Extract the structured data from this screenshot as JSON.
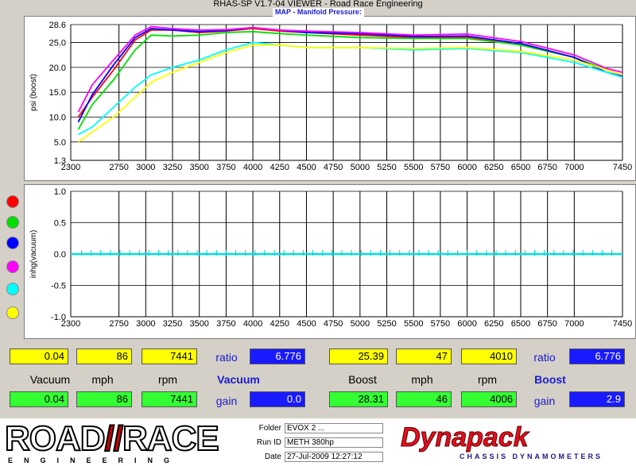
{
  "window": {
    "title": "RHAS-SP V1.7-04  VIEWER - Road Race Engineering"
  },
  "chart_data": [
    {
      "type": "line",
      "title": "MAP - Manifold Pressure:",
      "ylabel": "psi (boost)",
      "xlim": [
        2300,
        7450
      ],
      "ylim": [
        1.3,
        28.6
      ],
      "xticks": [
        2300,
        2750,
        3000,
        3250,
        3500,
        3750,
        4000,
        4250,
        4500,
        4750,
        5000,
        5250,
        5500,
        5750,
        6000,
        6250,
        6500,
        6750,
        7000,
        7450
      ],
      "yticks": [
        1.3,
        5.0,
        10.0,
        15.0,
        20.0,
        25.0,
        28.6
      ],
      "grid": true,
      "series": [
        {
          "color": "#ff0000",
          "x": [
            2370,
            2500,
            2700,
            2900,
            3050,
            3250,
            3500,
            3750,
            4000,
            4250,
            4500,
            5000,
            5500,
            6000,
            6500,
            7000,
            7300,
            7450
          ],
          "y": [
            10.0,
            14.0,
            19.5,
            25.5,
            27.5,
            27.5,
            27.0,
            27.3,
            27.8,
            27.3,
            27.0,
            26.5,
            26.0,
            26.0,
            24.5,
            22.0,
            19.5,
            18.5
          ]
        },
        {
          "color": "#00e000",
          "x": [
            2370,
            2500,
            2700,
            2900,
            3050,
            3250,
            3500,
            3750,
            4000,
            4250,
            4500,
            5000,
            5500,
            6000,
            6500,
            7000,
            7300,
            7450
          ],
          "y": [
            7.5,
            12.5,
            17.5,
            23.5,
            26.5,
            26.3,
            26.5,
            27.0,
            27.2,
            26.8,
            26.5,
            26.0,
            25.8,
            25.8,
            24.5,
            22.0,
            19.5,
            18.5
          ]
        },
        {
          "color": "#0000ff",
          "x": [
            2370,
            2500,
            2700,
            2900,
            3050,
            3250,
            3500,
            3750,
            4000,
            4250,
            4500,
            5000,
            5500,
            6000,
            6500,
            7000,
            7300,
            7450
          ],
          "y": [
            9.0,
            14.5,
            20.5,
            26.0,
            27.8,
            27.5,
            27.2,
            27.4,
            28.0,
            27.5,
            27.0,
            26.8,
            26.2,
            26.3,
            24.8,
            22.0,
            19.0,
            18.2
          ]
        },
        {
          "color": "#ff00ff",
          "x": [
            2370,
            2500,
            2700,
            2900,
            3050,
            3250,
            3500,
            3750,
            4000,
            4250,
            4500,
            5000,
            5500,
            6000,
            6500,
            7000,
            7300,
            7450
          ],
          "y": [
            11.0,
            16.5,
            21.5,
            26.5,
            28.2,
            27.8,
            27.5,
            27.6,
            28.0,
            27.5,
            27.3,
            27.0,
            26.5,
            26.7,
            25.2,
            22.5,
            19.8,
            19.0
          ]
        },
        {
          "color": "#00ffff",
          "x": [
            2370,
            2500,
            2700,
            2900,
            3050,
            3250,
            3500,
            3750,
            4000,
            4250,
            4500,
            5000,
            5500,
            6000,
            6500,
            7000,
            7300,
            7450
          ],
          "y": [
            6.5,
            8.0,
            12.0,
            16.0,
            18.5,
            20.0,
            21.5,
            23.5,
            25.0,
            24.5,
            24.0,
            24.0,
            23.5,
            23.8,
            23.0,
            21.0,
            19.0,
            18.0
          ]
        },
        {
          "color": "#ffff00",
          "x": [
            2370,
            2500,
            2700,
            2900,
            3050,
            3250,
            3500,
            3750,
            4000,
            4250,
            4500,
            5000,
            5500,
            6000,
            6500,
            7000,
            7300,
            7450
          ],
          "y": [
            5.0,
            7.0,
            10.0,
            14.0,
            17.0,
            19.0,
            21.0,
            23.0,
            24.5,
            24.5,
            24.0,
            24.0,
            23.8,
            24.0,
            23.2,
            21.5,
            19.5,
            18.5
          ]
        }
      ]
    },
    {
      "type": "line",
      "ylabel": "inhg(vacuum)",
      "xlim": [
        2300,
        7450
      ],
      "ylim": [
        -1.0,
        1.0
      ],
      "xticks": [
        2300,
        2750,
        3000,
        3250,
        3500,
        3750,
        4000,
        4250,
        4500,
        4750,
        5000,
        5250,
        5500,
        5750,
        6000,
        6250,
        6500,
        6750,
        7000,
        7450
      ],
      "yticks": [
        -1.0,
        -0.5,
        0.0,
        0.5,
        1.0
      ],
      "grid": true,
      "series": [
        {
          "color": "#00e0e0",
          "x": [
            2300,
            7450
          ],
          "y": [
            0.0,
            0.0
          ]
        }
      ]
    }
  ],
  "legend_swatches": [
    "#ff0000",
    "#00e000",
    "#0000ff",
    "#ff00ff",
    "#00ffff",
    "#ffff00"
  ],
  "panel": {
    "vacuum": {
      "row1": {
        "v1": "0.04",
        "v2": "86",
        "v3": "7441",
        "ratio_label": "ratio",
        "ratio": "6.776"
      },
      "labels": {
        "a": "Vacuum",
        "b": "mph",
        "c": "rpm",
        "title": "Vacuum"
      },
      "row2": {
        "v1": "0.04",
        "v2": "86",
        "v3": "7441",
        "gain_label": "gain",
        "gain": "0.0"
      }
    },
    "boost": {
      "row1": {
        "v1": "25.39",
        "v2": "47",
        "v3": "4010",
        "ratio_label": "ratio",
        "ratio": "6.776"
      },
      "labels": {
        "a": "Boost",
        "b": "mph",
        "c": "rpm",
        "title": "Boost"
      },
      "row2": {
        "v1": "28.31",
        "v2": "46",
        "v3": "4006",
        "gain_label": "gain",
        "gain": "2.9"
      }
    }
  },
  "footer": {
    "logo": {
      "main": "ROAD",
      "main2": "RACE",
      "sub": "ENGINEERING"
    },
    "info": [
      {
        "label": "Folder",
        "value": "EVOX 2 ..."
      },
      {
        "label": "Run ID",
        "value": "METH 380hp"
      },
      {
        "label": "Date",
        "value": "27-Jul-2009   12:27:12"
      }
    ],
    "dynapack": {
      "main": "Dynapack",
      "sub": "CHASSIS DYNAMOMETERS"
    }
  }
}
